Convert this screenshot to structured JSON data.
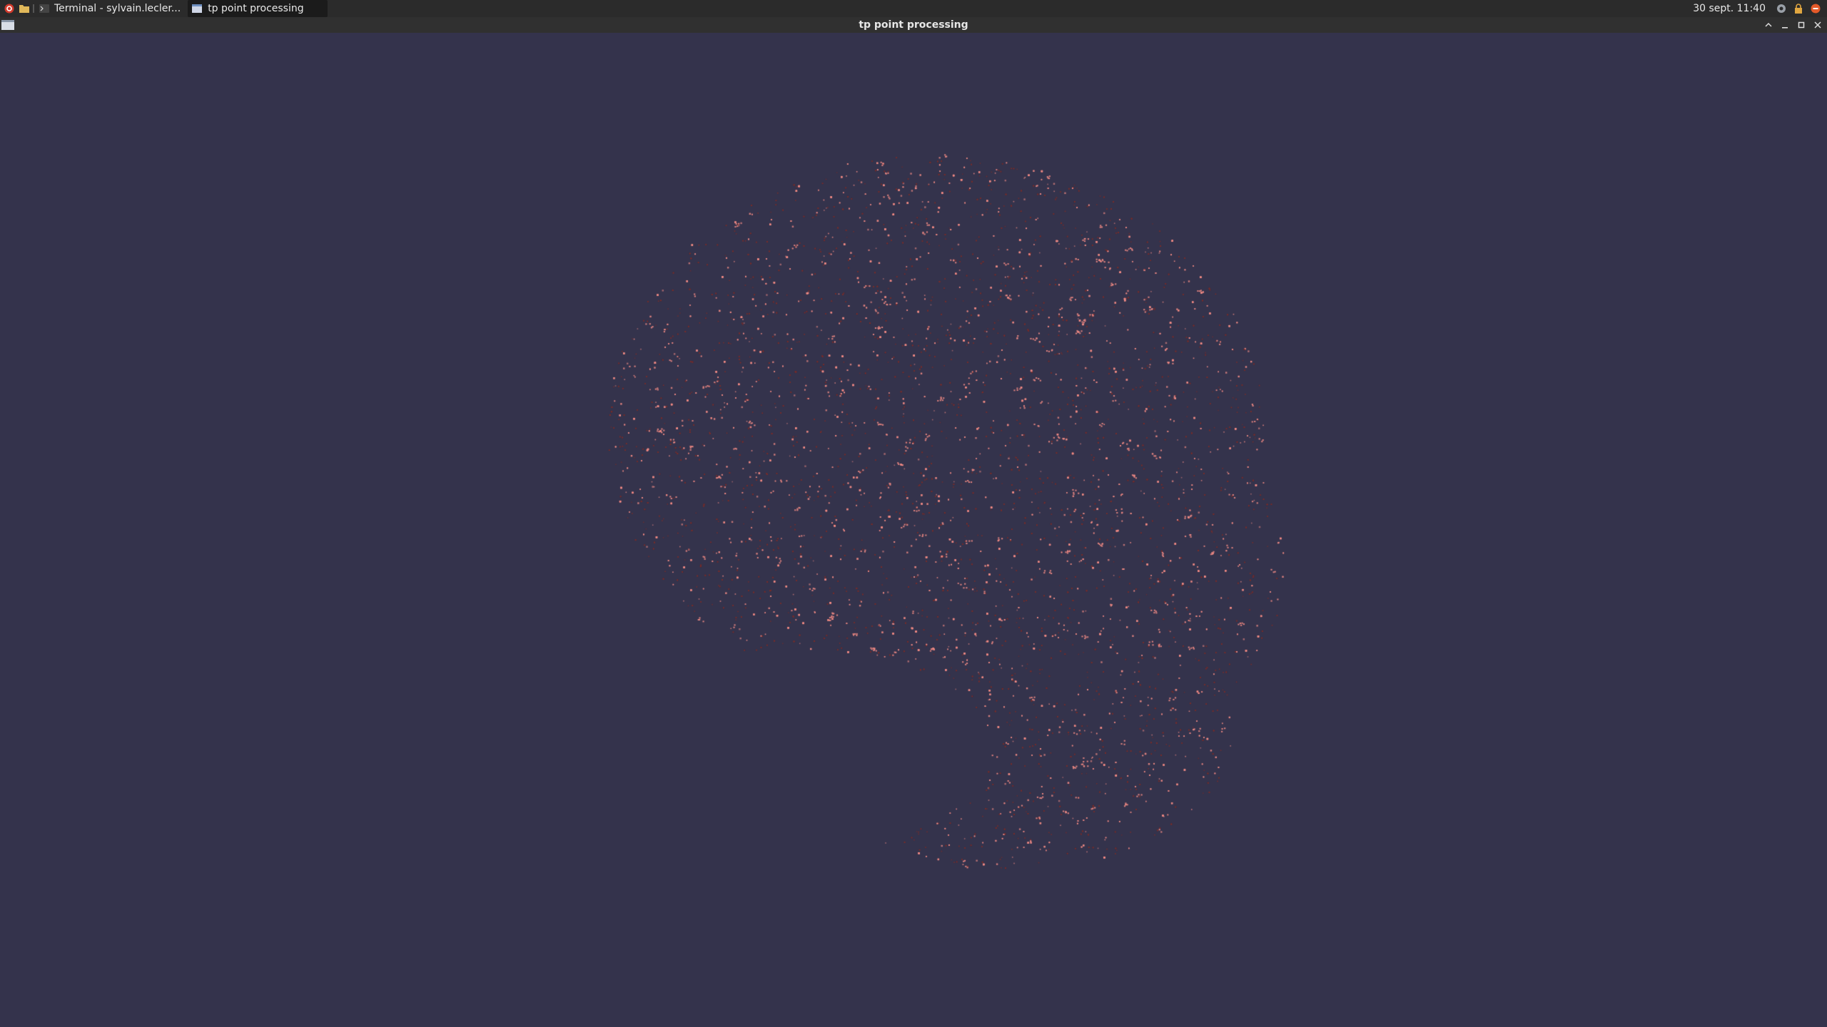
{
  "taskbar": {
    "tasks": [
      {
        "label": "Terminal - sylvain.lecler..."
      },
      {
        "label": "tp point processing"
      }
    ],
    "clock": "30 sept. 11:40"
  },
  "window": {
    "title": "tp point processing"
  },
  "colors": {
    "background": "#34334c",
    "point_bright": "#f08a84",
    "point_dark": "#7a2d2a"
  }
}
